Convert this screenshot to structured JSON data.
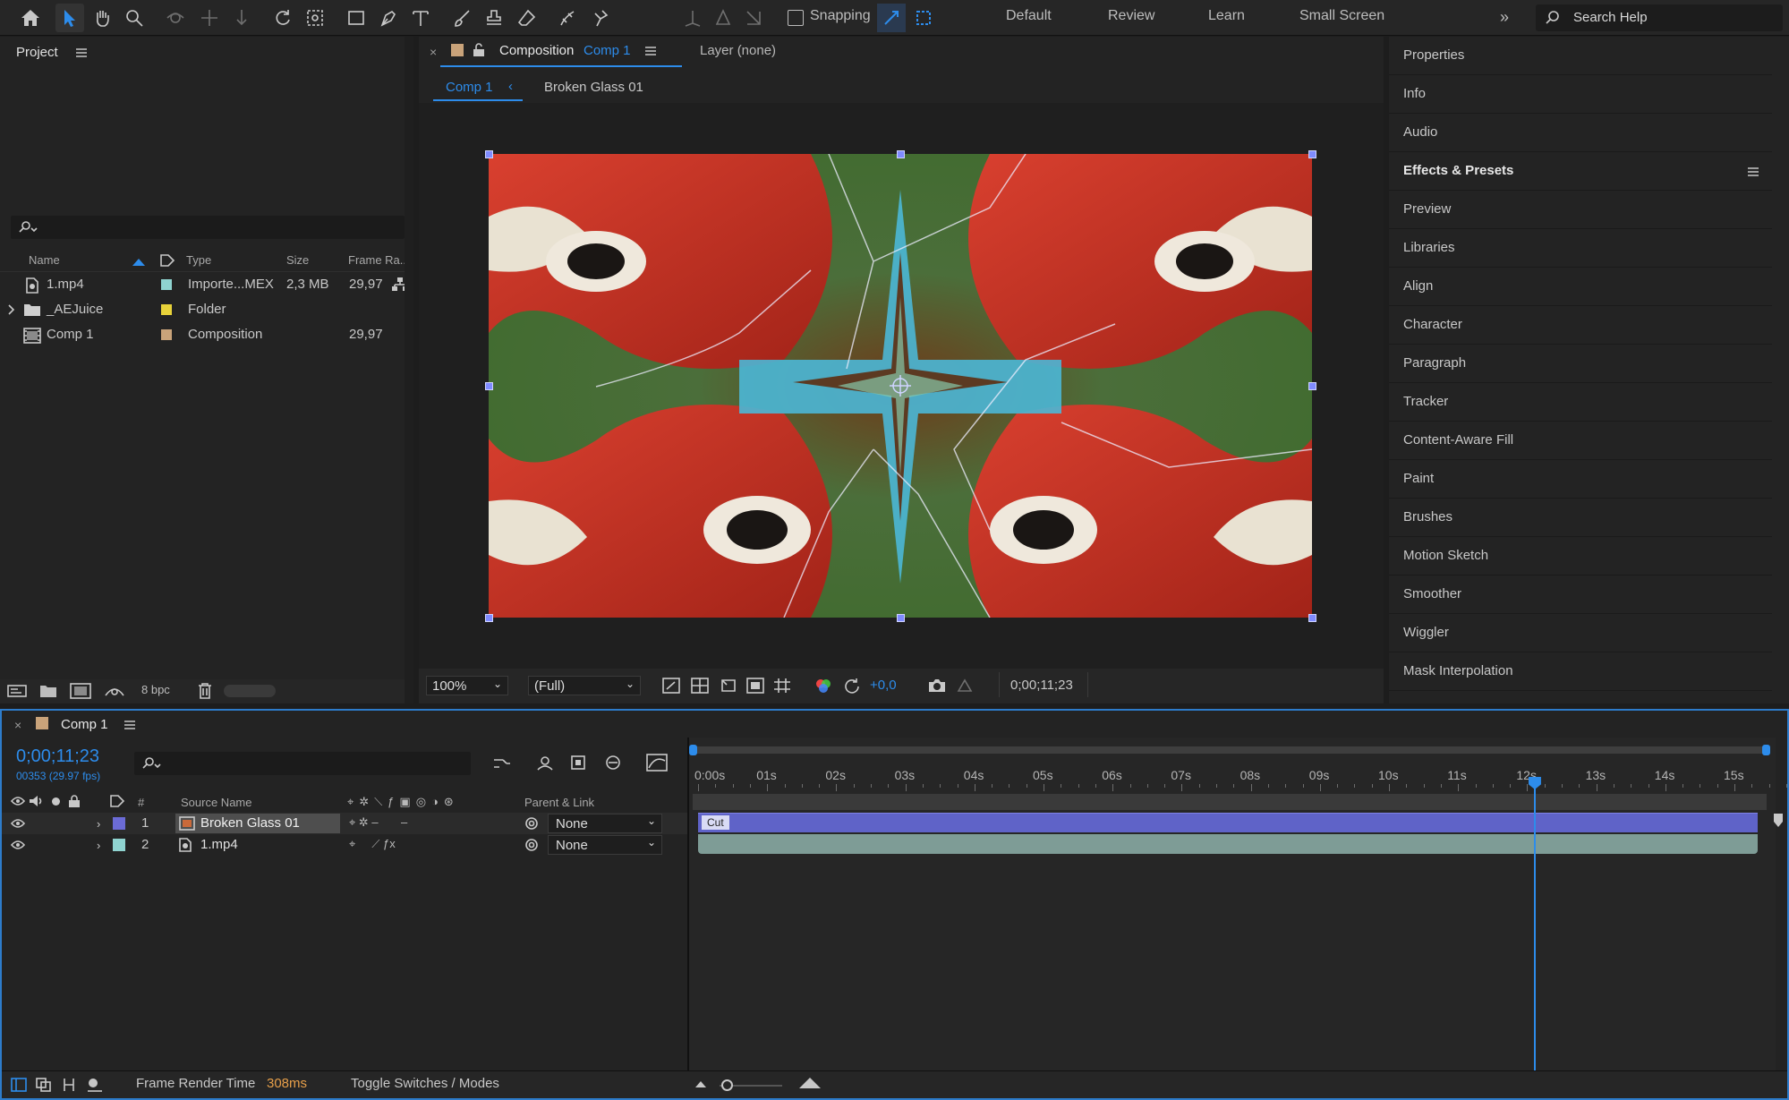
{
  "toolbar": {
    "snapping_label": "Snapping",
    "workspaces": [
      "Default",
      "Review",
      "Learn",
      "Small Screen"
    ],
    "search_placeholder": "Search Help"
  },
  "project": {
    "title": "Project",
    "columns": {
      "name": "Name",
      "type": "Type",
      "size": "Size",
      "frame_rate": "Frame Ra..."
    },
    "items": [
      {
        "name": "1.mp4",
        "type": "Importe...MEX",
        "size": "2,3 MB",
        "frame_rate": "29,97",
        "label_color": "#8fd3d0"
      },
      {
        "name": "_AEJuice",
        "type": "Folder",
        "size": "",
        "frame_rate": "",
        "label_color": "#e8d23a"
      },
      {
        "name": "Comp 1",
        "type": "Composition",
        "size": "",
        "frame_rate": "29,97",
        "label_color": "#c9a37a"
      }
    ],
    "bpc_label": "8 bpc"
  },
  "viewer": {
    "tab_prefix": "Composition",
    "tab_comp": "Comp 1",
    "layer_tab": "Layer (none)",
    "breadcrumb": [
      "Comp 1",
      "Broken Glass 01"
    ],
    "zoom": "100%",
    "resolution": "(Full)",
    "exposure": "+0,0",
    "timecode": "0;00;11;23"
  },
  "right_panel": {
    "items": [
      "Properties",
      "Info",
      "Audio",
      "Effects & Presets",
      "Preview",
      "Libraries",
      "Align",
      "Character",
      "Paragraph",
      "Tracker",
      "Content-Aware Fill",
      "Paint",
      "Brushes",
      "Motion Sketch",
      "Smoother",
      "Wiggler",
      "Mask Interpolation"
    ],
    "bold_item": "Effects & Presets"
  },
  "timeline": {
    "tab": "Comp 1",
    "timecode": "0;00;11;23",
    "frame_info": "00353 (29.97 fps)",
    "col_hash": "#",
    "col_source": "Source Name",
    "col_parent": "Parent & Link",
    "layers": [
      {
        "num": "1",
        "name": "Broken Glass 01",
        "parent": "None",
        "color": "#6b6bd6"
      },
      {
        "num": "2",
        "name": "1.mp4",
        "parent": "None",
        "color": "#8fd3d0"
      }
    ],
    "ruler": [
      "0:00s",
      "01s",
      "02s",
      "03s",
      "04s",
      "05s",
      "06s",
      "07s",
      "08s",
      "09s",
      "10s",
      "11s",
      "12s",
      "13s",
      "14s",
      "15s"
    ],
    "marker_label": "Cut",
    "current_time_fraction": 0.7833,
    "footer_render_label": "Frame Render Time",
    "footer_render_value": "308ms",
    "footer_toggle": "Toggle Switches / Modes"
  },
  "colors": {
    "accent_blue": "#2d8ceb",
    "layer_bar_purple": "#5f63c8",
    "layer_bar_teal": "#7e9c96",
    "render_time_orange": "#e8a04a"
  }
}
